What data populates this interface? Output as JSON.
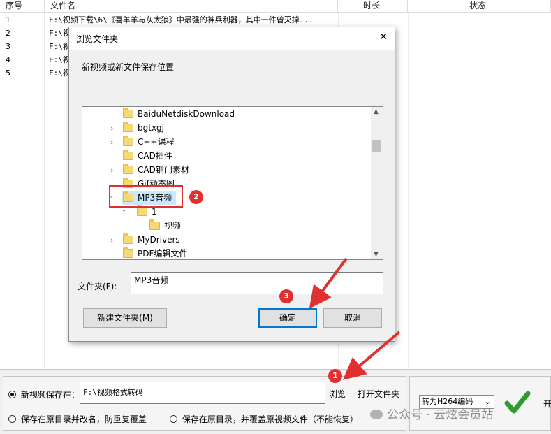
{
  "table": {
    "headers": {
      "index": "序号",
      "filename": "文件名",
      "duration": "时长",
      "status": "状态"
    },
    "rows": [
      {
        "index": "1",
        "filename": "F:\\视频下载\\6\\《喜羊羊与灰太狼》中最强的神兵利器，其中一件曾灭掉..."
      },
      {
        "index": "2",
        "filename": "F:\\视"
      },
      {
        "index": "3",
        "filename": "F:\\视"
      },
      {
        "index": "4",
        "filename": "F:\\视"
      },
      {
        "index": "5",
        "filename": "F:\\视"
      }
    ]
  },
  "bottom": {
    "save_new_label": "新视频保存在：",
    "save_path": "F:\\视频格式转码",
    "browse": "浏览",
    "open_folder": "打开文件夹",
    "save_rename_label": "保存在原目录并改名，防重复覆盖",
    "save_overwrite_label": "保存在原目录，并覆盖原视频文件（不能恢复）",
    "codec_value": "转为H264编码",
    "start_partial": "开",
    "watermark": "公众号 · 云炫会员站"
  },
  "dialog": {
    "title": "浏览文件夹",
    "close": "✕",
    "prompt": "新视频或新文件保存位置",
    "tree": [
      {
        "label": "BaiduNetdiskDownload"
      },
      {
        "label": "bgtxgj"
      },
      {
        "label": "C++课程"
      },
      {
        "label": "CAD插件"
      },
      {
        "label": "CAD铜门素材"
      },
      {
        "label": "Gif动态图"
      },
      {
        "label": "MP3音频"
      },
      {
        "label": "1"
      },
      {
        "label": "视频"
      },
      {
        "label": "MyDrivers"
      },
      {
        "label": "PDF编辑文件"
      }
    ],
    "folder_label": "文件夹(F):",
    "folder_value": "MP3音频",
    "new_folder": "新建文件夹(M)",
    "ok": "确定",
    "cancel": "取消"
  },
  "annotations": {
    "badge1": "1",
    "badge2": "2",
    "badge3": "3",
    "arrow_color": "#e03030"
  }
}
